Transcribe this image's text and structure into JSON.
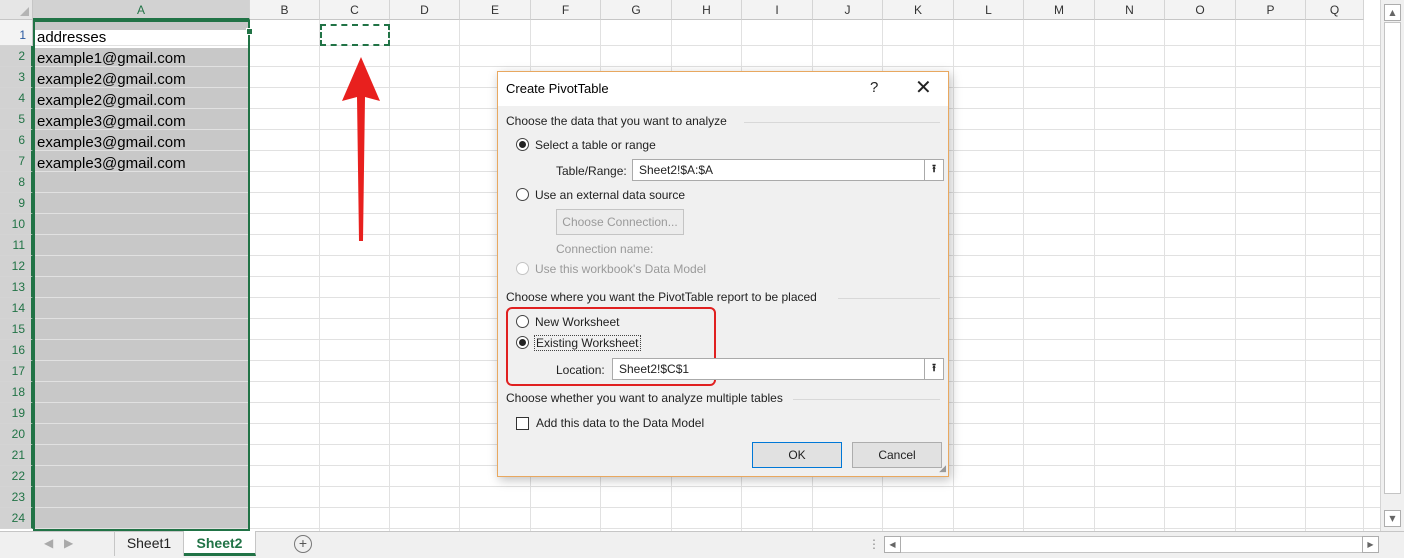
{
  "spreadsheet": {
    "columns": [
      "A",
      "B",
      "C",
      "D",
      "E",
      "F",
      "G",
      "H",
      "I",
      "J",
      "K",
      "L",
      "M",
      "N",
      "O",
      "P",
      "Q"
    ],
    "rows": [
      "1",
      "2",
      "3",
      "4",
      "5",
      "6",
      "7",
      "8",
      "9",
      "10",
      "11",
      "12",
      "13",
      "14",
      "15",
      "16",
      "17",
      "18",
      "19",
      "20",
      "21",
      "22",
      "23",
      "24"
    ],
    "column_a_cells": [
      "addresses",
      "example1@gmail.com",
      "example2@gmail.com",
      "example2@gmail.com",
      "example3@gmail.com",
      "example3@gmail.com",
      "example3@gmail.com"
    ],
    "selected_column": "A",
    "copy_target_cell": "C1"
  },
  "sheet_tabs": {
    "tabs": [
      "Sheet1",
      "Sheet2"
    ],
    "active": "Sheet2",
    "add_symbol": "+"
  },
  "dialog": {
    "title": "Create PivotTable",
    "help": "?",
    "close": "✕",
    "section1": "Choose the data that you want to analyze",
    "opt_table_range": "Select a table or range",
    "table_range_label": "Table/Range:",
    "table_range_value": "Sheet2!$A:$A",
    "opt_external": "Use an external data source",
    "choose_connection": "Choose Connection...",
    "connection_name": "Connection name:",
    "opt_data_model": "Use this workbook's Data Model",
    "section2": "Choose where you want the PivotTable report to be placed",
    "opt_new_ws": "New Worksheet",
    "opt_existing_ws": "Existing Worksheet",
    "location_label": "Location:",
    "location_value": "Sheet2!$C$1",
    "section3": "Choose whether you want to analyze multiple tables",
    "add_data_model": "Add this data to the Data Model",
    "ok": "OK",
    "cancel": "Cancel",
    "collapse_symbol": "⭱"
  },
  "annotation_colors": {
    "arrow": "#e8201e",
    "highlight_box": "#e02020",
    "excel_green": "#217346"
  }
}
